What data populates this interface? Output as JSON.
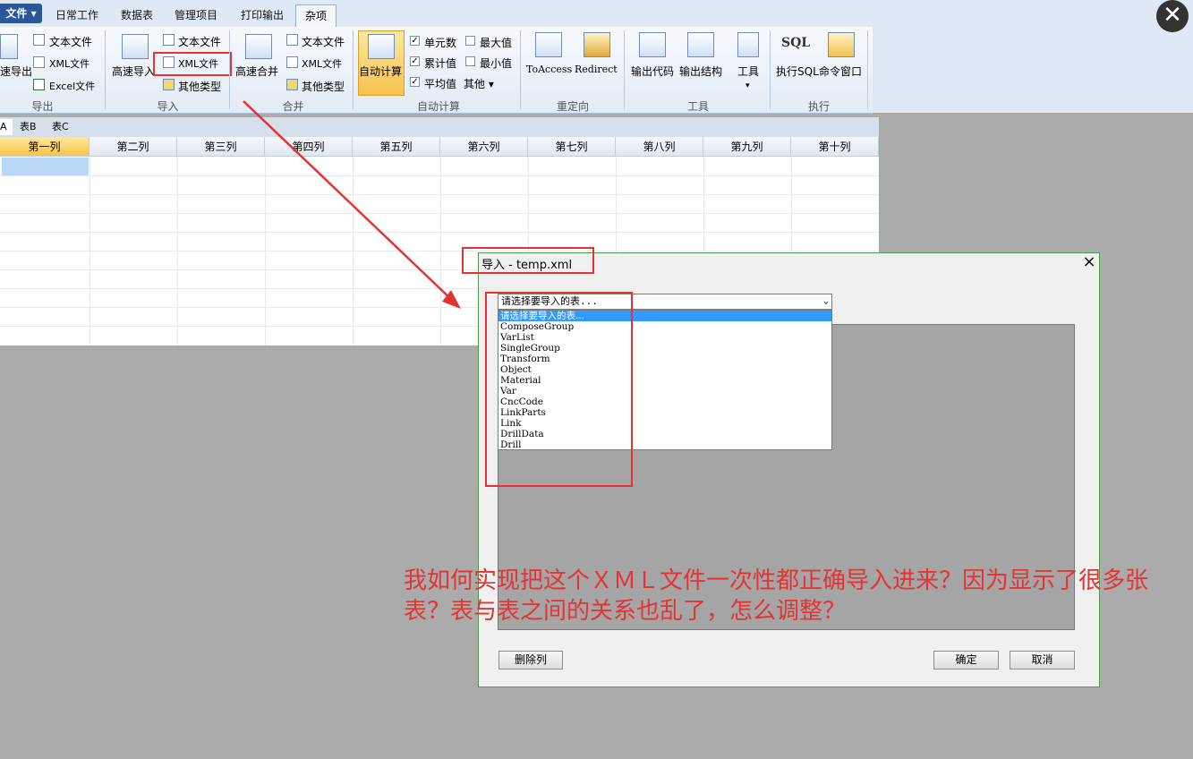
{
  "tabs": {
    "file": "文件",
    "items": [
      "日常工作",
      "数据表",
      "管理项目",
      "打印输出"
    ],
    "active": "杂项"
  },
  "ribbon": {
    "export": {
      "big_label": "速导出",
      "items": [
        "文本文件",
        "XML文件",
        "Excel文件"
      ],
      "group": "导出"
    },
    "import": {
      "big_label": "高速导入",
      "items": [
        "文本文件",
        "XML文件",
        "其他类型"
      ],
      "group": "导入"
    },
    "merge": {
      "big_label": "高速合并",
      "items": [
        "文本文件",
        "XML文件",
        "其他类型"
      ],
      "group": "合并"
    },
    "autocalc": {
      "big_label": "自动计算",
      "checks": [
        {
          "label": "单元数",
          "checked": true
        },
        {
          "label": "累计值",
          "checked": true
        },
        {
          "label": "平均值",
          "checked": true
        },
        {
          "label": "最大值",
          "checked": false
        },
        {
          "label": "最小值",
          "checked": false
        }
      ],
      "other": "其他",
      "group": "自动计算"
    },
    "redirect": {
      "items": [
        "ToAccess",
        "Redirect"
      ],
      "group": "重定向"
    },
    "tools": {
      "items": [
        "输出代码",
        "输出结构",
        "工具"
      ],
      "group": "工具"
    },
    "execute": {
      "items": [
        "执行SQL",
        "命令窗口"
      ],
      "sql_icon_text": "SQL",
      "group": "执行"
    }
  },
  "sheet_tabs": [
    "A",
    "表B",
    "表C"
  ],
  "grid": {
    "columns": [
      "第一列",
      "第二列",
      "第三列",
      "第四列",
      "第五列",
      "第六列",
      "第七列",
      "第八列",
      "第九列",
      "第十列"
    ]
  },
  "dialog": {
    "title": "导入 - temp.xml",
    "close": "×",
    "combo_value": "请选择要导入的表...",
    "options": [
      "请选择要导入的表...",
      "ComposeGroup",
      "VarList",
      "SingleGroup",
      "Transform",
      "Object",
      "Material",
      "Var",
      "CncCode",
      "LinkParts",
      "Link",
      "DrillData",
      "Drill"
    ],
    "selected_index": 0,
    "delete_column": "删除列",
    "ok": "确定",
    "cancel": "取消"
  },
  "annotation": {
    "question": "我如何实现把这个ＸＭＬ文件一次性都正确导入进来？因为显示了很多张表？表与表之间的关系也乱了，怎么调整？",
    "color": "#e53333"
  },
  "window_close": "✕"
}
